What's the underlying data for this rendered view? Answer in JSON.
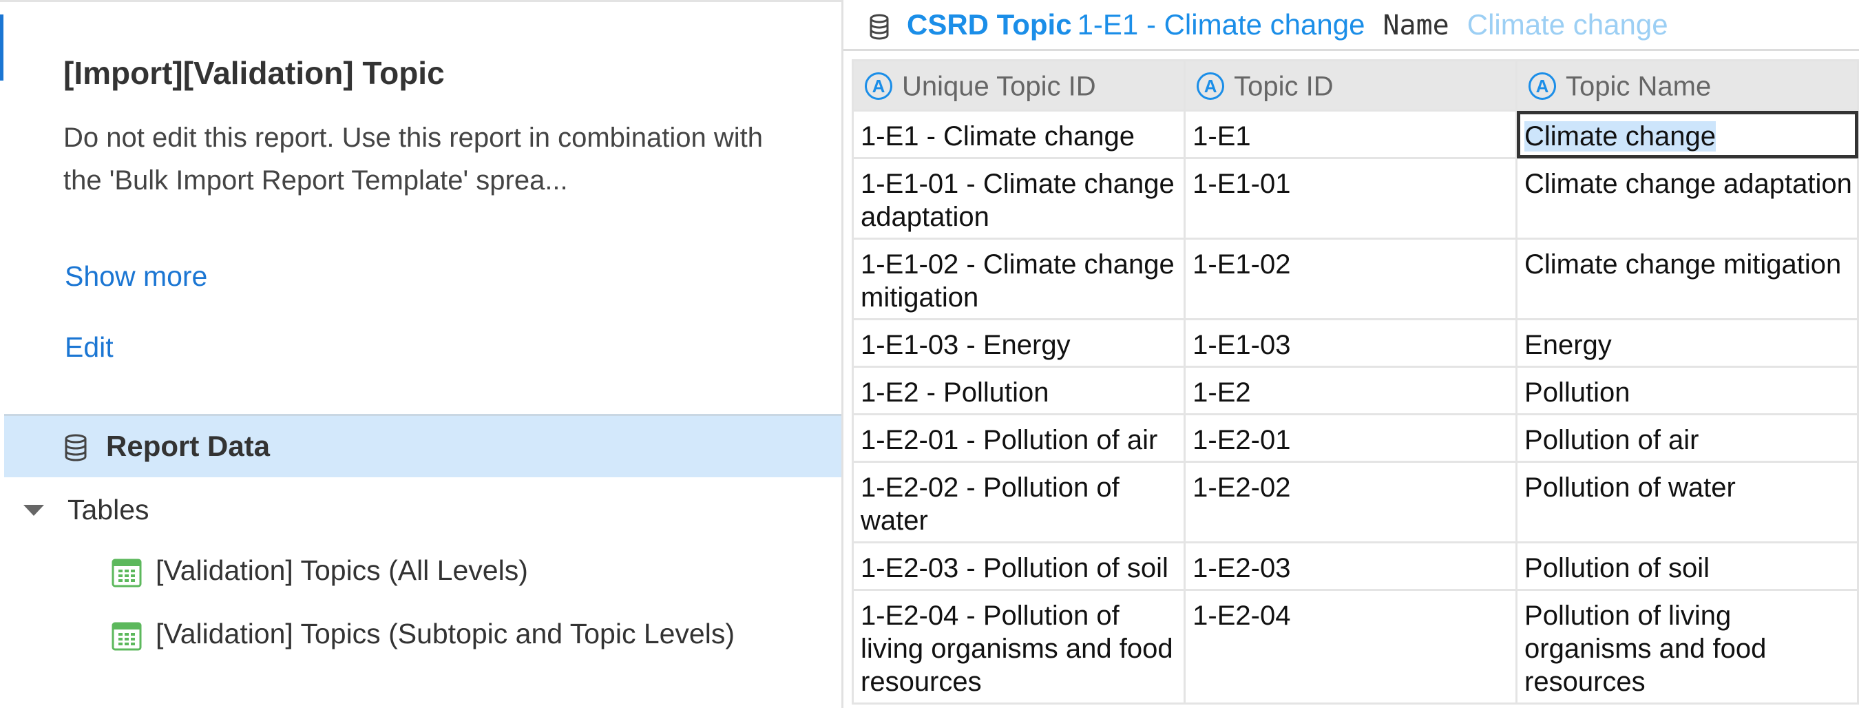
{
  "left": {
    "title": "[Import][Validation] Topic",
    "description": "Do not edit this report. Use this report in combination with the 'Bulk Import Report Template' sprea...",
    "show_more": "Show more",
    "edit": "Edit",
    "report_data_label": "Report Data",
    "tables_label": "Tables",
    "tables": [
      "[Validation] Topics (All Levels)",
      "[Validation] Topics (Subtopic and Topic Levels)"
    ]
  },
  "topbar": {
    "entity": "CSRD Topic",
    "record": "1-E1 - Climate change",
    "field": "Name",
    "value": "Climate change"
  },
  "grid": {
    "columns": [
      {
        "icon": "A",
        "label": "Unique Topic ID"
      },
      {
        "icon": "A",
        "label": "Topic ID"
      },
      {
        "icon": "A",
        "label": "Topic Name"
      }
    ],
    "rows": [
      [
        "1-E1 - Climate change",
        "1-E1",
        "Climate change"
      ],
      [
        "1-E1-01 - Climate change adaptation",
        "1-E1-01",
        "Climate change adaptation"
      ],
      [
        "1-E1-02 - Climate change mitigation",
        "1-E1-02",
        "Climate change mitigation"
      ],
      [
        "1-E1-03 - Energy",
        "1-E1-03",
        "Energy"
      ],
      [
        "1-E2 - Pollution",
        "1-E2",
        "Pollution"
      ],
      [
        "1-E2-01 - Pollution of air",
        "1-E2-01",
        "Pollution of air"
      ],
      [
        "1-E2-02 - Pollution of water",
        "1-E2-02",
        "Pollution of water"
      ],
      [
        "1-E2-03 - Pollution of soil",
        "1-E2-03",
        "Pollution of soil"
      ],
      [
        "1-E2-04 - Pollution of living organisms and food resources",
        "1-E2-04",
        "Pollution of living organisms and food resources"
      ]
    ]
  },
  "colors": {
    "accent": "#1b8ee8",
    "link": "#1b76d3",
    "selected_row_bg": "#d3e8fb",
    "table_icon": "#5cb85c"
  }
}
